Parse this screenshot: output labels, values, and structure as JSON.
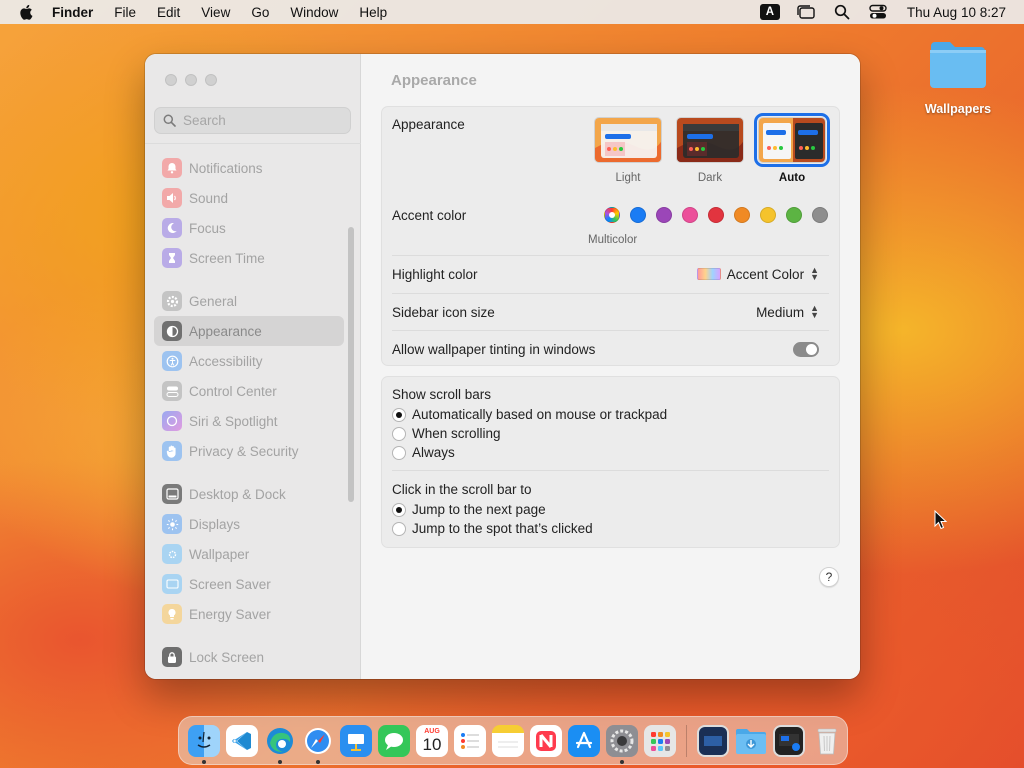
{
  "menubar": {
    "app": "Finder",
    "items": [
      "File",
      "Edit",
      "View",
      "Go",
      "Window",
      "Help"
    ],
    "input_source": "A",
    "clock": "Thu Aug 10  8:27"
  },
  "desktop": {
    "folder_label": "Wallpapers"
  },
  "sidebar": {
    "search_placeholder": "Search",
    "items": [
      {
        "label": "Notifications",
        "icon": "bell-icon",
        "color": "#f0a6a6"
      },
      {
        "label": "Sound",
        "icon": "speaker-icon",
        "color": "#f0a6a6"
      },
      {
        "label": "Focus",
        "icon": "moon-icon",
        "color": "#b7a8e6"
      },
      {
        "label": "Screen Time",
        "icon": "hourglass-icon",
        "color": "#b7a8e6"
      },
      {
        "label": "General",
        "icon": "gear-icon",
        "color": "#c0c0c0"
      },
      {
        "label": "Appearance",
        "icon": "appearance-icon",
        "color": "#6e6e6e"
      },
      {
        "label": "Accessibility",
        "icon": "accessibility-icon",
        "color": "#9cc2ef"
      },
      {
        "label": "Control Center",
        "icon": "control-center-icon",
        "color": "#c0c0c0"
      },
      {
        "label": "Siri & Spotlight",
        "icon": "siri-icon",
        "color": "#c4a6e6"
      },
      {
        "label": "Privacy & Security",
        "icon": "hand-icon",
        "color": "#9cc2ef"
      },
      {
        "label": "Desktop & Dock",
        "icon": "desktop-icon",
        "color": "#7a7a7a"
      },
      {
        "label": "Displays",
        "icon": "sun-icon",
        "color": "#9cc2ef"
      },
      {
        "label": "Wallpaper",
        "icon": "wallpaper-icon",
        "color": "#a9d4f2"
      },
      {
        "label": "Screen Saver",
        "icon": "screen-saver-icon",
        "color": "#a9d4f2"
      },
      {
        "label": "Energy Saver",
        "icon": "battery-icon",
        "color": "#f3d59a"
      },
      {
        "label": "Lock Screen",
        "icon": "lock-icon",
        "color": "#6e6e6e"
      }
    ],
    "active": "Appearance"
  },
  "content": {
    "title": "Appearance",
    "appearance": {
      "label": "Appearance",
      "options": [
        "Light",
        "Dark",
        "Auto"
      ],
      "selected": "Auto"
    },
    "accent": {
      "label": "Accent color",
      "colors": [
        "multicolor",
        "#1a7cf4",
        "#9b46b8",
        "#ec4f9a",
        "#e2343f",
        "#f08a24",
        "#f5c32c",
        "#5cb443",
        "#8e8e8e"
      ],
      "selected_caption": "Multicolor"
    },
    "highlight": {
      "label": "Highlight color",
      "value": "Accent Color"
    },
    "sidebar_icon_size": {
      "label": "Sidebar icon size",
      "value": "Medium"
    },
    "wallpaper_tinting": {
      "label": "Allow wallpaper tinting in windows",
      "enabled": true
    },
    "scroll_bars": {
      "label": "Show scroll bars",
      "options": [
        "Automatically based on mouse or trackpad",
        "When scrolling",
        "Always"
      ],
      "selected": 0
    },
    "scroll_click": {
      "label": "Click in the scroll bar to",
      "options": [
        "Jump to the next page",
        "Jump to the spot that’s clicked"
      ],
      "selected": 0
    },
    "help": "?"
  },
  "dock": {
    "calendar_month": "AUG",
    "calendar_day": "10",
    "apps": [
      "finder-icon",
      "vscode-icon",
      "edge-icon",
      "safari-icon",
      "keynote-icon",
      "messages-icon",
      "calendar-icon",
      "reminders-icon",
      "notes-icon",
      "news-icon",
      "app-store-icon",
      "system-settings-icon",
      "launchpad-icon",
      "screenshot-icon",
      "downloads-folder-icon",
      "preview-icon",
      "trash-icon"
    ]
  }
}
